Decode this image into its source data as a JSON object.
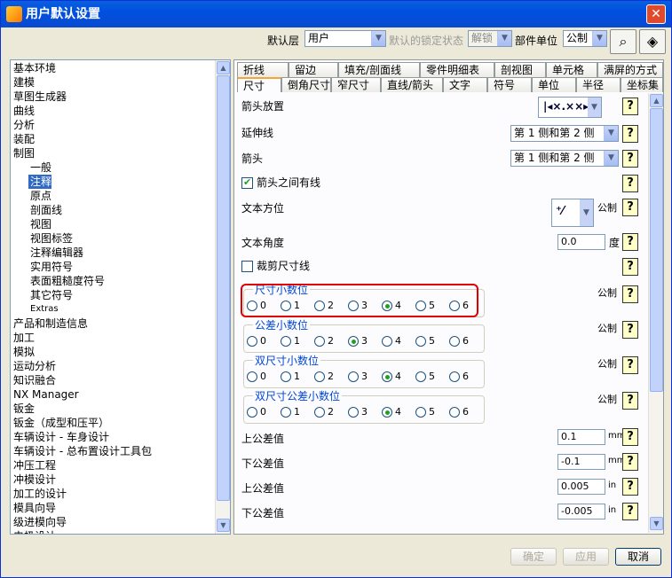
{
  "window": {
    "title": "用户默认设置"
  },
  "toolbar": {
    "layer_label": "默认层",
    "layer_value": "用户",
    "lock_label": "默认的锁定状态",
    "lock_value": "解锁",
    "unit_label": "部件单位",
    "unit_value": "公制"
  },
  "tree": {
    "items": [
      {
        "label": "基本环境"
      },
      {
        "label": "建模"
      },
      {
        "label": "草图生成器"
      },
      {
        "label": "曲线"
      },
      {
        "label": "分析"
      },
      {
        "label": "装配"
      },
      {
        "label": "制图"
      },
      {
        "label": "一般"
      },
      {
        "label": "注释"
      },
      {
        "label": "原点"
      },
      {
        "label": "剖面线"
      },
      {
        "label": "视图"
      },
      {
        "label": "视图标签"
      },
      {
        "label": "注释编辑器"
      },
      {
        "label": "实用符号"
      },
      {
        "label": "表面粗糙度符号"
      },
      {
        "label": "其它符号"
      },
      {
        "label": "Extras"
      },
      {
        "label": "产品和制造信息"
      },
      {
        "label": "加工"
      },
      {
        "label": "模拟"
      },
      {
        "label": "运动分析"
      },
      {
        "label": "知识融合"
      },
      {
        "label": "NX Manager"
      },
      {
        "label": "钣金"
      },
      {
        "label": "钣金（成型和压平）"
      },
      {
        "label": "车辆设计 - 车身设计"
      },
      {
        "label": "车辆设计 - 总布置设计工具包"
      },
      {
        "label": "冲压工程"
      },
      {
        "label": "冲模设计"
      },
      {
        "label": "加工的设计"
      },
      {
        "label": "模具向导"
      },
      {
        "label": "级进模向导"
      },
      {
        "label": "电极设计"
      }
    ]
  },
  "tabs_row1": [
    "折线",
    "留边",
    "填充/剖面线",
    "零件明细表",
    "剖视图",
    "单元格",
    "满屏的方式"
  ],
  "tabs_row2": [
    "尺寸",
    "倒角尺寸",
    "窄尺寸",
    "直线/箭头",
    "文字",
    "符号",
    "单位",
    "半径",
    "坐标集"
  ],
  "settings": {
    "arrow_place": "箭头放置",
    "ext_line": "延伸线",
    "ext_value": "第 1 侧和第 2 侧",
    "arrow": "箭头",
    "arrow_value": "第 1 侧和第 2 侧",
    "line_between": "箭头之间有线",
    "text_orient": "文本方位",
    "text_angle": "文本角度",
    "angle_value": "0.0",
    "degree": "度",
    "crop": "裁剪尺寸线",
    "metric": "公制",
    "help": "?"
  },
  "groups": [
    {
      "title": "尺寸小数位",
      "options": [
        "0",
        "1",
        "2",
        "3",
        "4",
        "5",
        "6"
      ],
      "selected": 4
    },
    {
      "title": "公差小数位",
      "options": [
        "0",
        "1",
        "2",
        "3",
        "4",
        "5",
        "6"
      ],
      "selected": 3
    },
    {
      "title": "双尺寸小数位",
      "options": [
        "0",
        "1",
        "2",
        "3",
        "4",
        "5",
        "6"
      ],
      "selected": 4
    },
    {
      "title": "双尺寸公差小数位",
      "options": [
        "0",
        "1",
        "2",
        "3",
        "4",
        "5",
        "6"
      ],
      "selected": 4
    }
  ],
  "tolerances": [
    {
      "label": "上公差值",
      "value": "0.1",
      "unit": "mm"
    },
    {
      "label": "下公差值",
      "value": "-0.1",
      "unit": "mm"
    },
    {
      "label": "上公差值",
      "value": "0.005",
      "unit": "in"
    },
    {
      "label": "下公差值",
      "value": "-0.005",
      "unit": "in"
    }
  ],
  "buttons": {
    "ok": "确定",
    "apply": "应用",
    "cancel": "取消"
  }
}
